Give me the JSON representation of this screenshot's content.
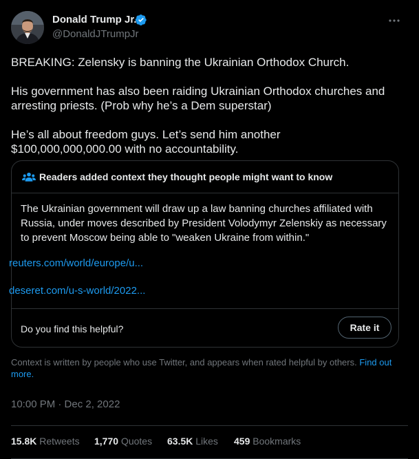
{
  "author": {
    "name": "Donald Trump Jr.",
    "handle": "@DonaldJTrumpJr",
    "verified": true
  },
  "tweet": {
    "paragraphs": [
      "BREAKING: Zelensky is banning the Ukrainian Orthodox Church.",
      "His government has also been raiding Ukrainian Orthodox churches and\narresting priests. (Prob why he’s a Dem superstar)",
      "He’s all about freedom guys. Let’s send him another\n$100,000,000,000.00 with no accountability."
    ]
  },
  "note": {
    "title": "Readers added context they thought people might want to know",
    "body": "The Ukrainian government will draw up a law banning churches affiliated with Russia, under moves described by President Volodymyr Zelenskiy as necessary to prevent Moscow being able to \"weaken Ukraine from within.\"",
    "links": [
      "reuters.com/world/europe/u...",
      "deseret.com/u-s-world/2022..."
    ],
    "question": "Do you find this helpful?",
    "rate_label": "Rate it"
  },
  "context_info": {
    "text": "Context is written by people who use Twitter, and appears when rated helpful by others.",
    "link": "Find out more."
  },
  "timestamp": "10:00 PM · Dec 2, 2022",
  "stats": {
    "retweets": {
      "count": "15.8K",
      "label": "Retweets"
    },
    "quotes": {
      "count": "1,770",
      "label": "Quotes"
    },
    "likes": {
      "count": "63.5K",
      "label": "Likes"
    },
    "bookmarks": {
      "count": "459",
      "label": "Bookmarks"
    }
  },
  "colors": {
    "background": "#000000",
    "text": "#e7e9ea",
    "muted": "#71767b",
    "link": "#1d9bf0",
    "verified": "#1d9bf0",
    "border": "#2f3336"
  },
  "icons": [
    "verified-badge-icon",
    "more-icon",
    "community-notes-icon"
  ]
}
